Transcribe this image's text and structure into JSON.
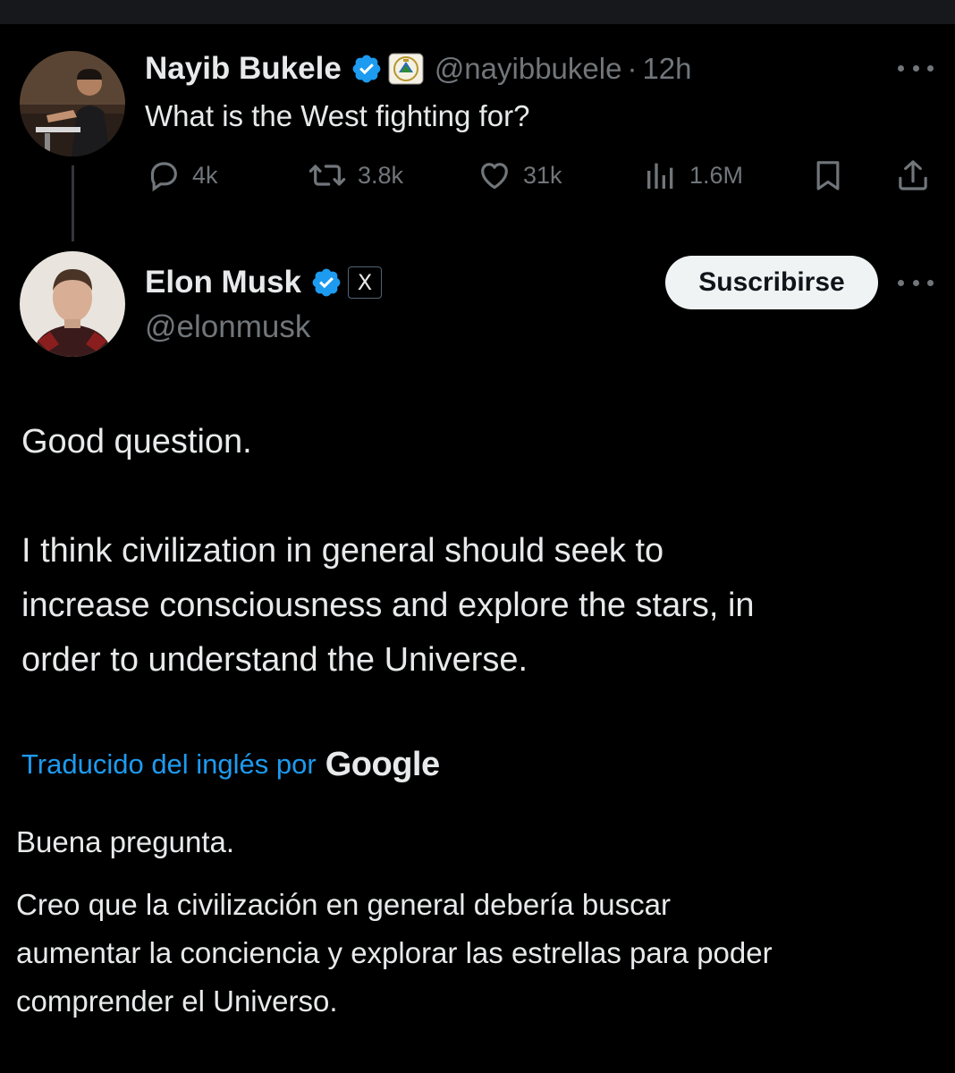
{
  "parent_tweet": {
    "author_name": "Nayib Bukele",
    "handle": "@nayibbukele",
    "separator": "·",
    "time": "12h",
    "text": "What is the West fighting for?",
    "stats": {
      "replies": "4k",
      "reposts": "3.8k",
      "likes": "31k",
      "views": "1.6M"
    }
  },
  "reply_tweet": {
    "author_name": "Elon Musk",
    "handle": "@elonmusk",
    "subscribe_label": "Suscribirse",
    "affiliate_badge": "X",
    "paragraph_1": "Good question.",
    "paragraph_2_lines": [
      "I think civilization in general should seek to",
      "increase consciousness and explore the stars, in",
      "order to understand the Universe."
    ],
    "translation": {
      "link_label": "Traducido del inglés por",
      "provider": "Google",
      "paragraph_1": "Buena pregunta.",
      "paragraph_2_lines": [
        "Creo que la civilización en general debería buscar",
        "aumentar la conciencia y explorar las estrellas para poder",
        "comprender el Universo."
      ]
    }
  },
  "colors": {
    "background": "#000000",
    "text": "#e7e9ea",
    "muted": "#71767b",
    "verified": "#1d9bf0",
    "link": "#1d9bf0"
  },
  "icons": {
    "reply": "speech-bubble-icon",
    "repost": "repost-arrows-icon",
    "like": "heart-icon",
    "views": "bar-chart-icon",
    "bookmark": "bookmark-icon",
    "share": "share-upload-icon",
    "more": "more-dots-icon",
    "verified": "verified-badge-icon",
    "affiliation": "coat-of-arms-badge-icon"
  }
}
